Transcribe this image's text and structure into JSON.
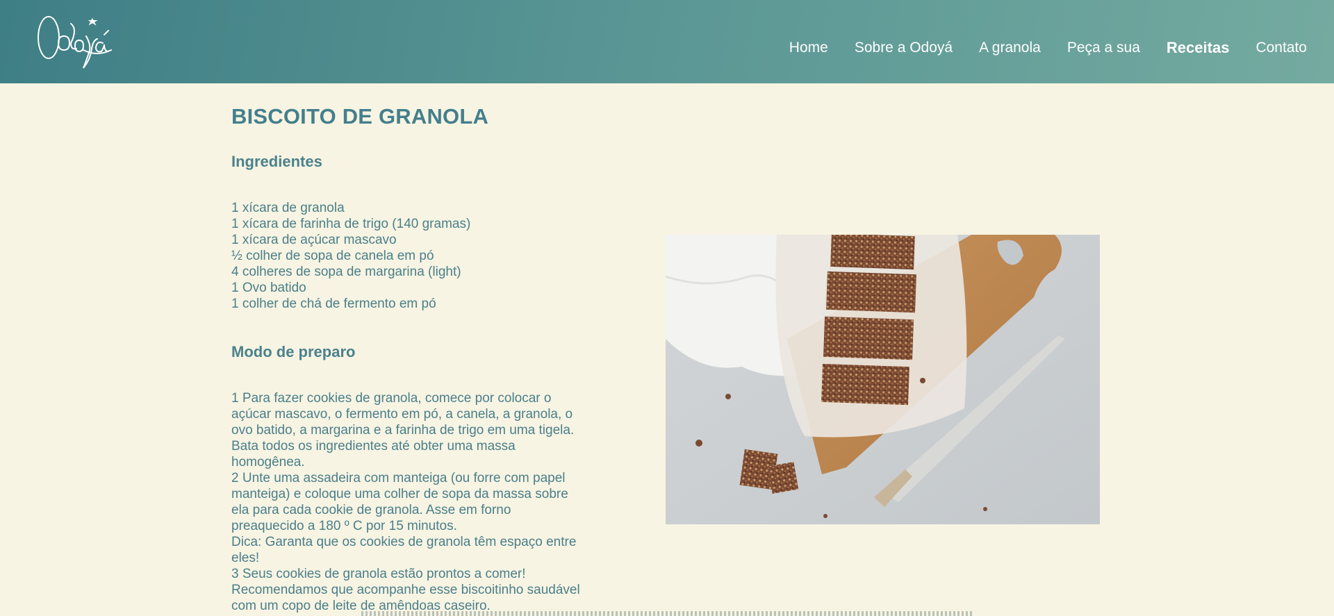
{
  "header": {
    "logo_alt": "Odoyá",
    "nav": [
      {
        "label": "Home",
        "active": false
      },
      {
        "label": "Sobre a Odoyá",
        "active": false
      },
      {
        "label": "A granola",
        "active": false
      },
      {
        "label": "Peça a sua",
        "active": false
      },
      {
        "label": "Receitas",
        "active": true
      },
      {
        "label": "Contato",
        "active": false
      }
    ]
  },
  "recipe": {
    "title": "BISCOITO DE GRANOLA",
    "ingredients_heading": "Ingredientes",
    "ingredients": [
      "1 xícara de granola",
      "1 xícara de farinha de trigo (140 gramas)",
      "1 xícara de açúcar mascavo",
      "½ colher de sopa de canela em pó",
      "4 colheres de sopa de margarina (light)",
      "1 Ovo batido",
      "1 colher de chá de fermento em pó"
    ],
    "method_heading": "Modo de preparo",
    "steps": [
      "1 Para fazer cookies de granola, comece por colocar o açúcar mascavo, o fermento em pó, a canela, a granola, o ovo batido, a margarina e a farinha de trigo em uma tigela. Bata todos os ingredientes até obter uma massa homogênea.",
      "2 Unte uma assadeira com manteiga (ou forre com papel manteiga) e coloque uma colher de sopa da massa sobre ela para cada cookie de granola. Asse em forno preaquecido a 180 º C por 15 minutos.",
      "Dica: Garanta que os cookies de granola têm espaço entre eles!",
      "3 Seus cookies de granola estão prontos a comer! Recomendamos que acompanhe esse biscoitinho saudável com um copo de leite de amêndoas caseiro."
    ]
  },
  "colors": {
    "header_start": "#3e7e85",
    "header_end": "#74aaa0",
    "background": "#f7f4e3",
    "text": "#4a7f89"
  }
}
